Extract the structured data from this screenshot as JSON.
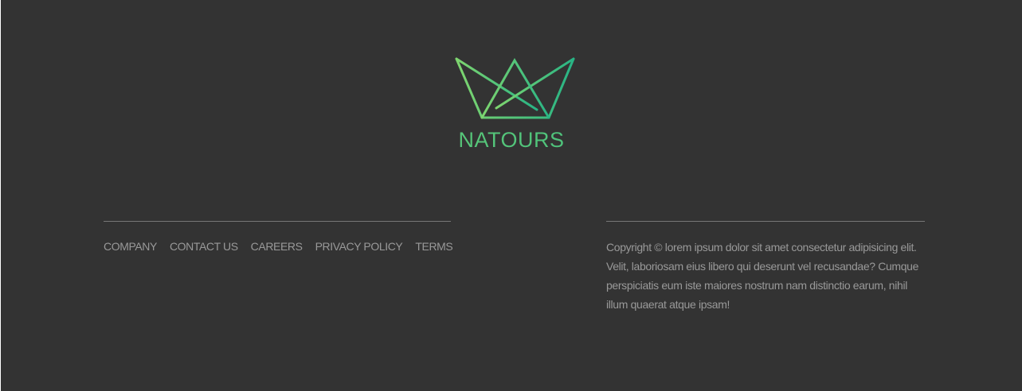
{
  "brand": {
    "name": "NATOURS",
    "logo_icon": "crown-icon",
    "gradient": [
      "#7ed56f",
      "#28b485"
    ]
  },
  "footer": {
    "background": "#333333",
    "text_color": "#999999",
    "divider_color": "#777777",
    "nav": [
      {
        "label": "COMPANY",
        "name": "company"
      },
      {
        "label": "CONTACT US",
        "name": "contact-us"
      },
      {
        "label": "CAREERS",
        "name": "careers"
      },
      {
        "label": "PRIVACY POLICY",
        "name": "privacy-policy"
      },
      {
        "label": "TERMS",
        "name": "terms"
      }
    ],
    "copyright": "Copyright © lorem ipsum dolor sit amet consectetur adipisicing elit. Velit, laboriosam eius libero qui deserunt vel recusandae? Cumque perspiciatis eum iste maiores nostrum nam distinctio earum, nihil illum quaerat atque ipsam!"
  }
}
